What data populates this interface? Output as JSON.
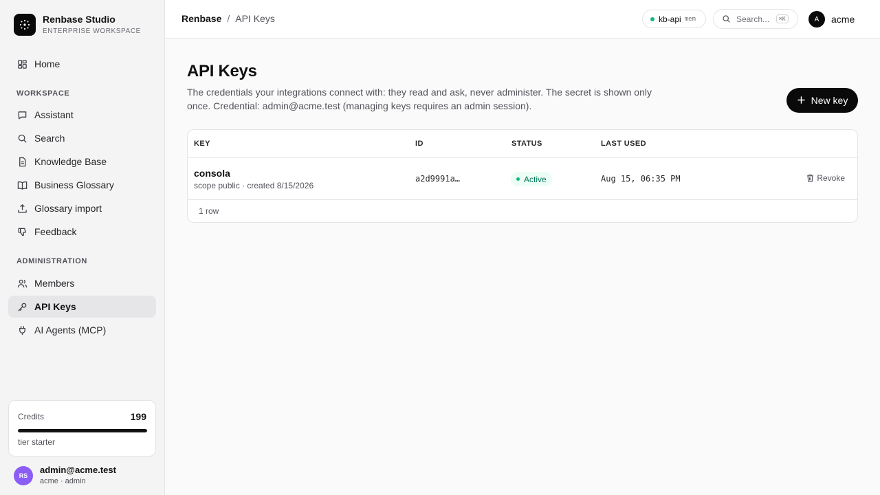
{
  "brand": {
    "name": "Renbase Studio",
    "subtitle": "ENTERPRISE WORKSPACE"
  },
  "nav": {
    "home": "Home",
    "workspace_heading": "WORKSPACE",
    "assistant": "Assistant",
    "search": "Search",
    "knowledge_base": "Knowledge Base",
    "business_glossary": "Business Glossary",
    "glossary_import": "Glossary import",
    "feedback": "Feedback",
    "administration_heading": "ADMINISTRATION",
    "members": "Members",
    "api_keys": "API Keys",
    "ai_agents": "AI Agents (MCP)"
  },
  "credits": {
    "label": "Credits",
    "value": "199",
    "tier": "tier starter",
    "progress": 1.0
  },
  "user": {
    "initials": "RS",
    "email": "admin@acme.test",
    "role": "acme · admin"
  },
  "header": {
    "breadcrumb_root": "Renbase",
    "breadcrumb_sep": "/",
    "breadcrumb_current": "API Keys",
    "env_name": "kb-api",
    "env_tag": "mem",
    "search_placeholder": "Search...",
    "search_shortcut": "⌘K",
    "account_initial": "A",
    "account_name": "acme"
  },
  "page": {
    "title": "API Keys",
    "description": "The credentials your integrations connect with: they read and ask, never administer. The secret is shown only once. Credential: admin@acme.test (managing keys requires an admin session).",
    "new_key_label": "New key"
  },
  "table": {
    "columns": {
      "key": "KEY",
      "id": "ID",
      "status": "STATUS",
      "last_used": "LAST USED"
    },
    "rows": [
      {
        "name": "consola",
        "meta": "scope public · created 8/15/2026",
        "id": "a2d9991a…",
        "status": "Active",
        "last_used": "Aug 15, 06:35 PM",
        "action": "Revoke"
      }
    ],
    "footer": "1 row"
  },
  "colors": {
    "accent": "#0a0a0a",
    "status_active": "#10b981",
    "avatar": "#8b5cf6"
  }
}
